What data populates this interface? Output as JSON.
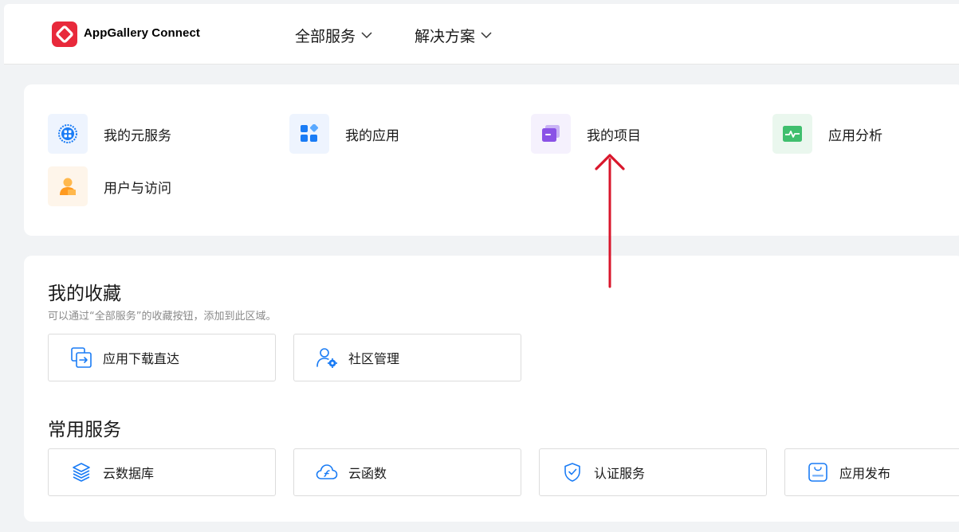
{
  "header": {
    "brand": "AppGallery Connect",
    "nav": [
      {
        "label": "全部服务"
      },
      {
        "label": "解决方案"
      }
    ]
  },
  "quick_links": [
    {
      "label": "我的元服务",
      "icon": "atomic-service-icon"
    },
    {
      "label": "我的应用",
      "icon": "apps-icon"
    },
    {
      "label": "我的项目",
      "icon": "project-icon"
    },
    {
      "label": "应用分析",
      "icon": "analytics-icon"
    },
    {
      "label": "用户与访问",
      "icon": "user-icon"
    }
  ],
  "favorites": {
    "title": "我的收藏",
    "hint": "可以通过“全部服务”的收藏按钮，添加到此区域。",
    "items": [
      {
        "label": "应用下载直达",
        "icon": "download-direct-icon"
      },
      {
        "label": "社区管理",
        "icon": "community-manage-icon"
      }
    ]
  },
  "common": {
    "title": "常用服务",
    "items": [
      {
        "label": "云数据库",
        "icon": "cloud-database-icon"
      },
      {
        "label": "云函数",
        "icon": "cloud-function-icon"
      },
      {
        "label": "认证服务",
        "icon": "auth-service-icon"
      },
      {
        "label": "应用发布",
        "icon": "app-release-icon"
      }
    ]
  },
  "colors": {
    "accent_blue": "#1a7cf5",
    "brand_red": "#e8293b",
    "annotation_arrow": "#d9162b"
  }
}
